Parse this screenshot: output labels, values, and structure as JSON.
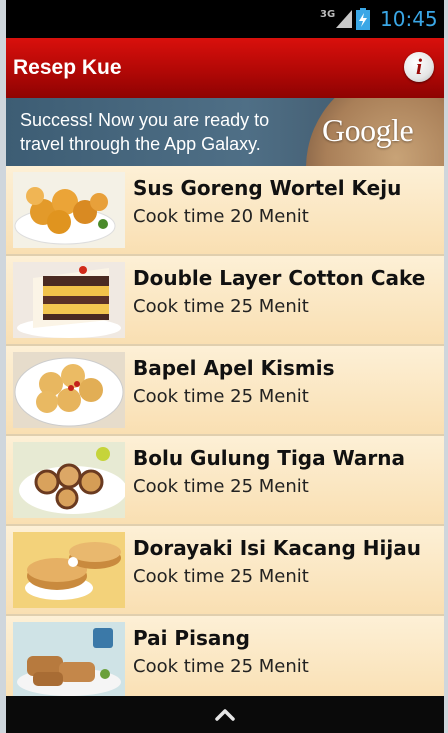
{
  "status": {
    "network": "3G",
    "time": "10:45"
  },
  "header": {
    "title": "Resep Kue",
    "info_glyph": "i"
  },
  "ad": {
    "line1": "Success! Now you are ready to",
    "line2": "travel through the App Galaxy.",
    "brand": "Google"
  },
  "recipes": [
    {
      "name": "Sus Goreng Wortel Keju",
      "time": "Cook time 20 Menit"
    },
    {
      "name": "Double Layer Cotton Cake",
      "time": "Cook time 25 Menit"
    },
    {
      "name": "Bapel Apel Kismis",
      "time": "Cook time 25 Menit"
    },
    {
      "name": "Bolu Gulung Tiga Warna",
      "time": "Cook time 25 Menit"
    },
    {
      "name": "Dorayaki Isi Kacang Hijau",
      "time": "Cook time 25 Menit"
    },
    {
      "name": "Pai Pisang",
      "time": "Cook time 25 Menit"
    }
  ],
  "colors": {
    "header": "#b20806",
    "list_bg": "#fbe7c4",
    "clock": "#3aa7e6"
  },
  "icons": [
    "signal-icon",
    "battery-icon",
    "info-icon",
    "chevron-up-icon"
  ]
}
